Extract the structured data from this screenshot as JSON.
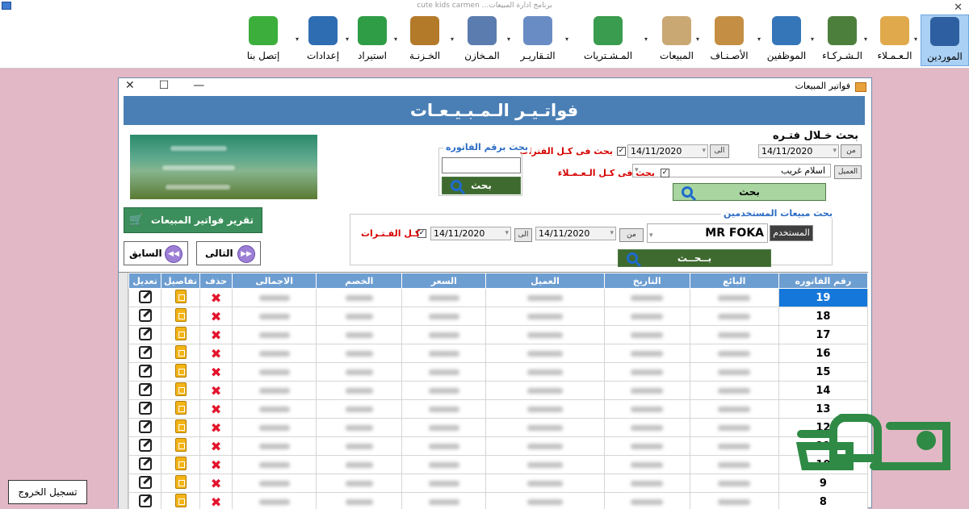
{
  "app": {
    "title": "cute kids carmen ...برنامج ادارة المبيعات"
  },
  "ribbon": {
    "items": [
      {
        "label": "إتصل بنا",
        "icon": "phone-icon",
        "color": "#3cae3c"
      },
      {
        "label": "إعدادات",
        "icon": "settings-gear-icon",
        "color": "#2f6db3"
      },
      {
        "label": "استيراد",
        "icon": "excel-icon",
        "color": "#2f9d46"
      },
      {
        "label": "الخـزنـة",
        "icon": "safe-icon",
        "color": "#b37a2a"
      },
      {
        "label": "المـخازن",
        "icon": "warehouse-icon",
        "color": "#5b7cae"
      },
      {
        "label": "التـقاريـر",
        "icon": "reports-icon",
        "color": "#6a8cc4"
      },
      {
        "label": "المـشـتريات",
        "icon": "cart-icon",
        "color": "#3a9c4e"
      },
      {
        "label": "المبيعات",
        "icon": "sales-icon",
        "color": "#c9a874"
      },
      {
        "label": "الأصـنـاف",
        "icon": "box-icon",
        "color": "#c48f44"
      },
      {
        "label": "الموظفين",
        "icon": "employee-icon",
        "color": "#3576b8"
      },
      {
        "label": "الـشـركـاء",
        "icon": "partners-icon",
        "color": "#4d7f3c"
      },
      {
        "label": "الـعـمـلاء",
        "icon": "customers-icon",
        "color": "#e0a94b"
      },
      {
        "label": "الموردين",
        "icon": "suppliers-icon",
        "color": "#2d5fa1"
      }
    ]
  },
  "window": {
    "title": "فواتير المبيعات",
    "banner": "فواتـيـر الـمـبـيـعـات"
  },
  "search_period": {
    "title": "بحث خـلال فتـره",
    "from_tag": "من",
    "to_tag": "الى",
    "from_date": "14/11/2020",
    "to_date": "14/11/2020",
    "all_periods_label": "بحث فى كـل الفترات",
    "customer_tag": "العميل",
    "customer_value": "اسلام غريب",
    "all_customers_label": "بحث فى كـل الـعـمـلاء",
    "search_button": "بحث"
  },
  "invoice_search": {
    "title": "بحث برقم الفاتوره",
    "value": "",
    "button": "بحث"
  },
  "user_search": {
    "title": "بحث مبيعات المستخدمين",
    "user_tag": "المستخدم",
    "user_value": "MR FOKA",
    "from_tag": "من",
    "to_tag": "الى",
    "from_date": "14/11/2020",
    "to_date": "14/11/2020",
    "all_periods_label": "كـل الفـتـرات",
    "button": "بــحــث"
  },
  "report_button": "تقرير فواتير المبيعات",
  "nav": {
    "next": "التالى",
    "prev": "السابق"
  },
  "grid": {
    "headers": [
      "رقم الفاتوره",
      "البائع",
      "التاريخ",
      "العميل",
      "السعر",
      "الخصم",
      "الاجمالى",
      "حذف",
      "تفاصيل",
      "تعديل"
    ],
    "invoice_numbers": [
      "19",
      "18",
      "17",
      "16",
      "15",
      "14",
      "13",
      "12",
      "11",
      "10",
      "9",
      "8"
    ],
    "selected_row": 0
  },
  "logout_button": "تسجيل الخروج",
  "watermark": "فوكه"
}
